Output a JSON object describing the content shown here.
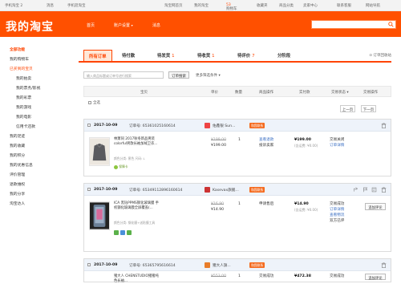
{
  "topbar": {
    "greeting": "手机淘宝 2",
    "message": "消息",
    "phone": "手机逛淘宝",
    "home": "淘宝网首页",
    "mytaobao": "我的淘宝",
    "cart": "购物车",
    "cart_count": "53",
    "fav": "收藏夹",
    "categories": "商品分类",
    "seller": "卖家中心",
    "contact": "联系客服",
    "sitemap": "网站导航"
  },
  "header": {
    "logo": "我的淘宝",
    "nav": [
      "首页",
      "账户设置",
      "消息"
    ]
  },
  "sidebar": {
    "items": [
      {
        "label": "全部功能",
        "kind": "head"
      },
      {
        "label": "我的购物车",
        "kind": "item"
      },
      {
        "label": "已买到的宝贝",
        "kind": "active"
      },
      {
        "label": "我的拍卖",
        "kind": "sub"
      },
      {
        "label": "我的票务/影视",
        "kind": "sub"
      },
      {
        "label": "我的彩票",
        "kind": "sub"
      },
      {
        "label": "我的游戏",
        "kind": "sub"
      },
      {
        "label": "我的电影",
        "kind": "sub"
      },
      {
        "label": "信用卡还款",
        "kind": "sub"
      },
      {
        "label": "我的足迹",
        "kind": "item"
      },
      {
        "label": "我的收藏",
        "kind": "item"
      },
      {
        "label": "我的积分",
        "kind": "item"
      },
      {
        "label": "我的优惠信息",
        "kind": "item"
      },
      {
        "label": "评价管理",
        "kind": "item"
      },
      {
        "label": "退款维权",
        "kind": "item"
      },
      {
        "label": "我的分享",
        "kind": "item"
      },
      {
        "label": "淘宝达人",
        "kind": "item"
      }
    ]
  },
  "tabs": {
    "items": [
      {
        "label": "所有订单",
        "count": ""
      },
      {
        "label": "待付款",
        "count": ""
      },
      {
        "label": "待发货",
        "count": "1"
      },
      {
        "label": "待收货",
        "count": "1"
      },
      {
        "label": "待评价",
        "count": "7"
      },
      {
        "label": "分阶段",
        "count": ""
      }
    ],
    "recycle": "订单回收站"
  },
  "filter": {
    "placeholder": "输入商品标题或订单号进行搜索",
    "search_btn": "订单搜索",
    "more": "更多筛选条件"
  },
  "table": {
    "headers": [
      "宝贝",
      "单价",
      "数量",
      "商品操作",
      "实付款",
      "交易状态",
      "交易操作"
    ],
    "select_all": "全选",
    "prev": "上一页",
    "next": "下一页"
  },
  "orders": [
    {
      "date": "2017-10-09",
      "order_no": "订单号: 65361025160614",
      "shop": "佑鑫银 Sun...",
      "chat": "和我联系",
      "title": "林萧同 2017秋冬新品男装colorful男款长袖加绒卫衣...",
      "meta": "颜色分类: 黑色 尺码: L",
      "badge": "保障卡",
      "unit_old": "¥199.00",
      "unit_price": "¥199.00",
      "qty": "1",
      "ops": [
        "查看退款",
        "投诉卖家"
      ],
      "paid": "¥199.00",
      "paid_sub": "(含运费: ¥0.00)",
      "status": [
        "交易关闭",
        "订单详情"
      ],
      "action": ""
    },
    {
      "date": "2017-10-09",
      "order_no": "订单号: 65349112896160614",
      "shop": "Kasevax旗舰...",
      "chat": "和我联系",
      "title": "ICA 黑钻PPMS钢化玻璃膜 手机钢化玻璃膜全屏覆盖(...",
      "meta": "颜色分类: 钢化膜+送贴膜工具",
      "badge": "",
      "unit_old": "¥16.90",
      "unit_price": "¥14.90",
      "qty": "1",
      "ops": [
        "申请售后"
      ],
      "paid": "¥14.90",
      "paid_sub": "(含运费: ¥0.00)",
      "status": [
        "交易成功",
        "订单详情",
        "查看物流",
        "双方已评",
        "双方已评"
      ],
      "action": "追加评论"
    },
    {
      "date": "2017-10-09",
      "order_no": "订单号: 65365795616614",
      "shop": "猪大人旗...",
      "chat": "和我联系",
      "title": "猪大人 CHENSTUDIO猪猪纯色长袖...",
      "meta": "",
      "badge": "",
      "unit_old": "¥553.00",
      "unit_price": "",
      "qty": "1",
      "ops": [
        "交易成功"
      ],
      "paid": "¥472.38",
      "paid_sub": "",
      "status": [
        "交易成功"
      ],
      "action": "追加评论"
    }
  ],
  "colors": {
    "brand": "#ff5000",
    "tab_active_bg": "#ffe8d8",
    "order_head": "#eef3fa",
    "link": "#3c70c4"
  }
}
